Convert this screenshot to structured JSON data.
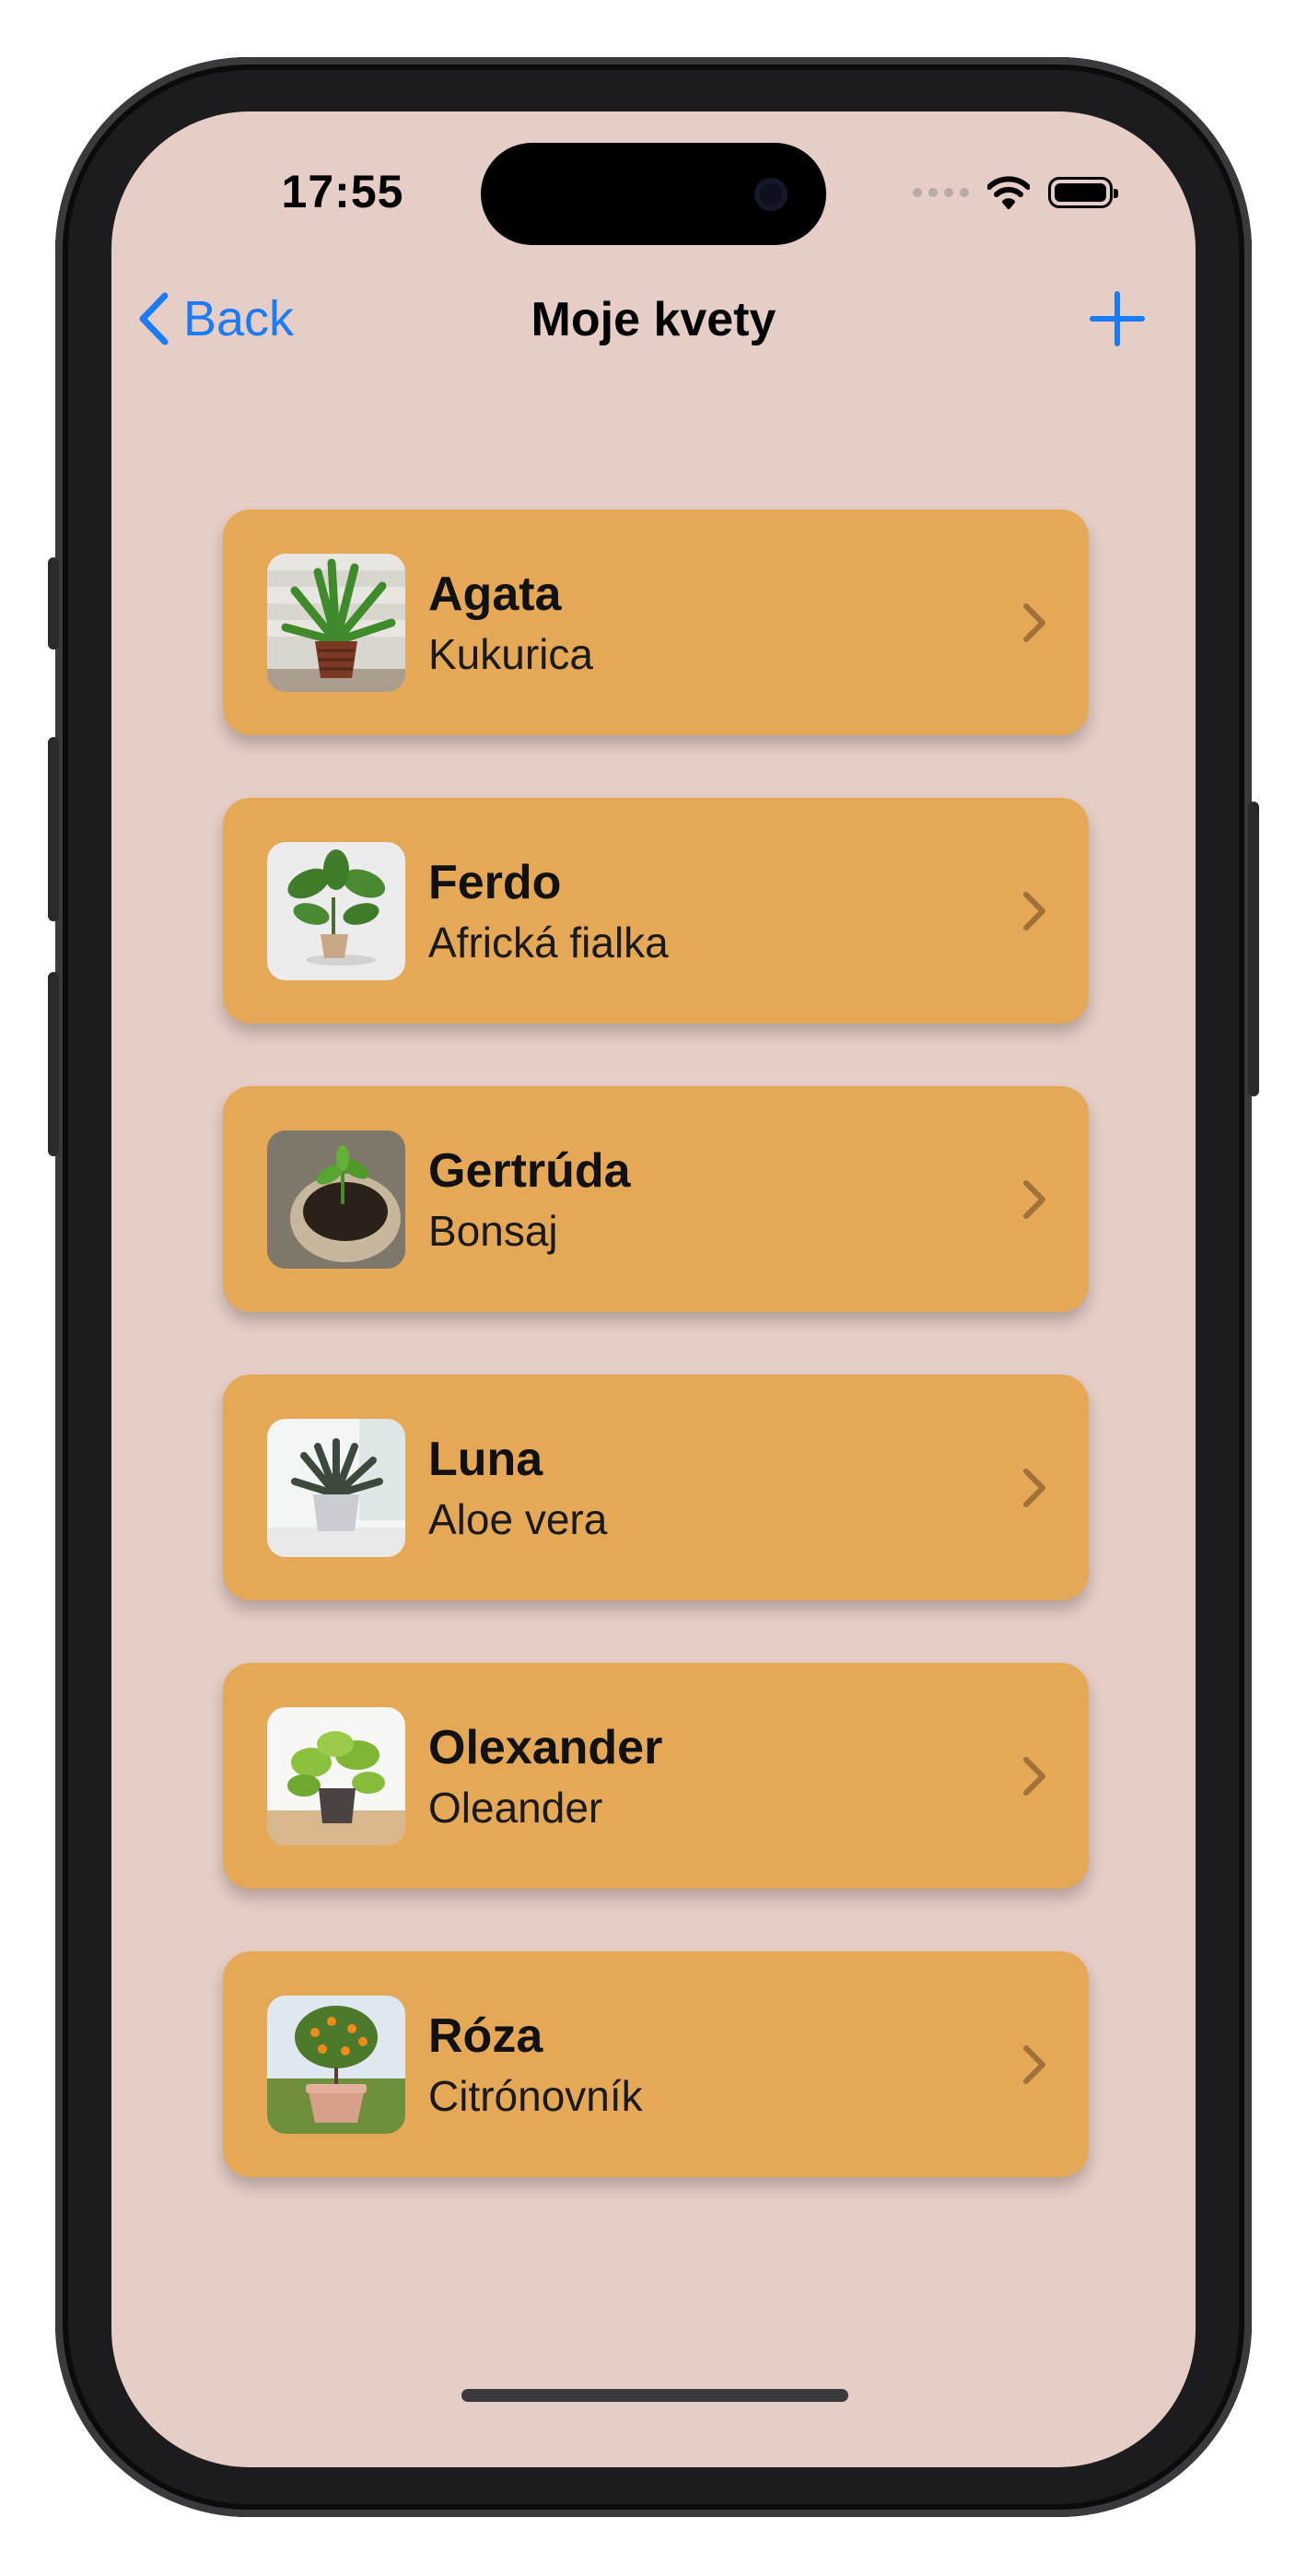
{
  "status_bar": {
    "time": "17:55"
  },
  "nav": {
    "back_label": "Back",
    "title": "Moje kvety",
    "add_icon": "plus-icon"
  },
  "plants": [
    {
      "name": "Agata",
      "species": "Kukurica",
      "thumb_icon": "plant-photo-icon"
    },
    {
      "name": "Ferdo",
      "species": "Africká fialka",
      "thumb_icon": "plant-photo-icon"
    },
    {
      "name": "Gertrúda",
      "species": "Bonsaj",
      "thumb_icon": "plant-photo-icon"
    },
    {
      "name": "Luna",
      "species": "Aloe vera",
      "thumb_icon": "plant-photo-icon"
    },
    {
      "name": "Olexander",
      "species": "Oleander",
      "thumb_icon": "plant-photo-icon"
    },
    {
      "name": "Róza",
      "species": "Citrónovník",
      "thumb_icon": "plant-photo-icon"
    }
  ],
  "colors": {
    "background": "#e6cdc5",
    "card": "#e5a857",
    "accent": "#1a7cf4"
  }
}
